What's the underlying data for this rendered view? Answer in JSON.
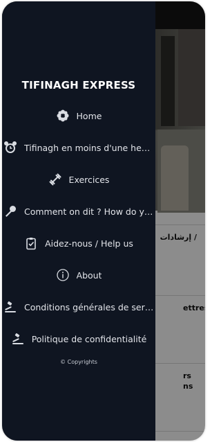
{
  "drawer": {
    "title": "TIFINAGH EXPRESS",
    "items": [
      {
        "label": "Home",
        "icon": "flower-icon"
      },
      {
        "label": "Tifinagh en moins d'une heure",
        "icon": "alarm-clock-icon"
      },
      {
        "label": "Exercices",
        "icon": "dumbbell-icon"
      },
      {
        "label": "Comment on dit ? How do you say?",
        "icon": "microphone-icon"
      },
      {
        "label": "Aidez-nous / Help us",
        "icon": "clipboard-icon"
      },
      {
        "label": "About",
        "icon": "info-icon"
      },
      {
        "label": "Conditions générales de service",
        "icon": "gavel-icon"
      },
      {
        "label": "Politique de confidentialité",
        "icon": "gavel-icon"
      }
    ],
    "copyright": "© Copyrights"
  },
  "background": {
    "card1_line1": "إرشادات /",
    "card2_line1": "ettres",
    "card3_line1": "rs",
    "card3_line2": "ns"
  },
  "colors": {
    "drawer_bg": "#0f1521",
    "text": "#e3e5ea"
  }
}
